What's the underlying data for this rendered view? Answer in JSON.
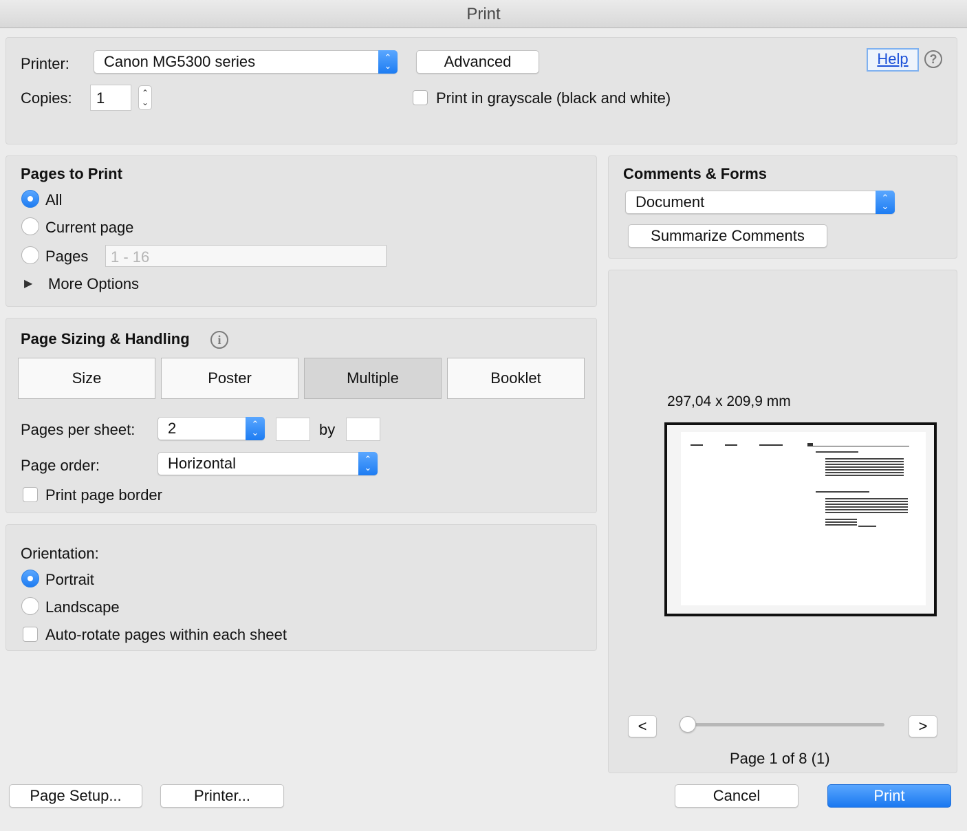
{
  "window": {
    "title": "Print"
  },
  "top": {
    "printer_label": "Printer:",
    "printer_value": "Canon MG5300 series",
    "advanced_label": "Advanced",
    "help_label": "Help",
    "copies_label": "Copies:",
    "copies_value": "1",
    "grayscale_label": "Print in grayscale (black and white)"
  },
  "pages_to_print": {
    "title": "Pages to Print",
    "all_label": "All",
    "current_label": "Current page",
    "pages_label": "Pages",
    "pages_placeholder": "1 - 16",
    "more_label": "More Options"
  },
  "sizing": {
    "title": "Page Sizing & Handling",
    "tabs": [
      {
        "label": "Size"
      },
      {
        "label": "Poster"
      },
      {
        "label": "Multiple"
      },
      {
        "label": "Booklet"
      }
    ],
    "selected_tab": "Multiple",
    "pps_label": "Pages per sheet:",
    "pps_value": "2",
    "by_label": "by",
    "order_label": "Page order:",
    "order_value": "Horizontal",
    "border_label": "Print page border"
  },
  "orientation": {
    "title": "Orientation:",
    "portrait_label": "Portrait",
    "landscape_label": "Landscape",
    "autorotate_label": "Auto-rotate pages within each sheet"
  },
  "comments": {
    "title": "Comments & Forms",
    "value": "Document",
    "summarize_label": "Summarize Comments"
  },
  "preview": {
    "dimensions": "297,04 x 209,9 mm",
    "prev_label": "<",
    "next_label": ">",
    "page_info": "Page 1 of 8 (1)",
    "slider_value": 0
  },
  "footer": {
    "page_setup_label": "Page Setup...",
    "printer_label": "Printer...",
    "cancel_label": "Cancel",
    "print_label": "Print"
  },
  "colors": {
    "accent": "#1d7cf2",
    "panel": "#e4e4e4",
    "background": "#ececec"
  },
  "icons": {
    "help": "question-circle-icon",
    "info": "info-circle-icon",
    "disclosure": "triangle-right-icon"
  }
}
